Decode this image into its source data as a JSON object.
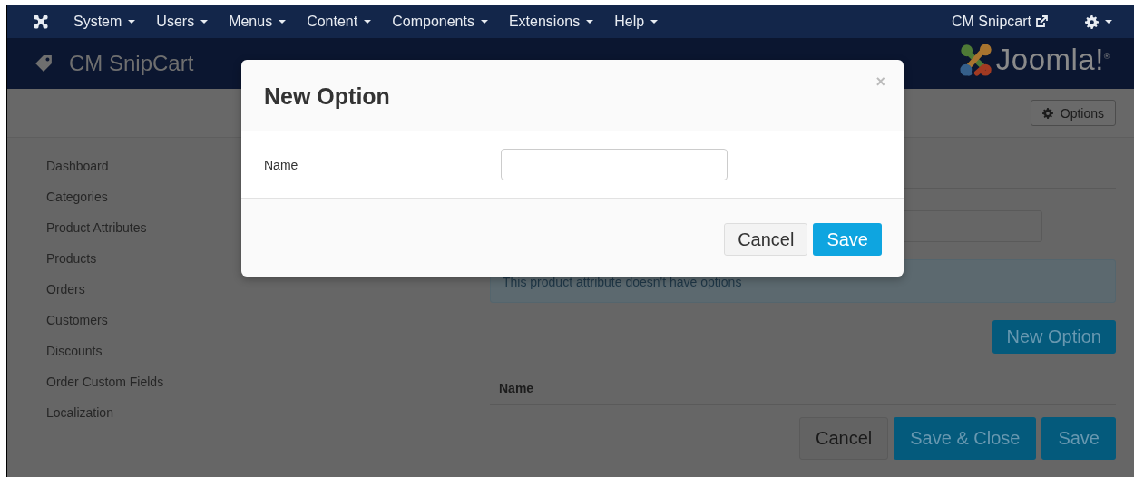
{
  "navbar": {
    "menus": [
      {
        "label": "System"
      },
      {
        "label": "Users"
      },
      {
        "label": "Menus"
      },
      {
        "label": "Content"
      },
      {
        "label": "Components"
      },
      {
        "label": "Extensions"
      },
      {
        "label": "Help"
      }
    ],
    "site_link": "CM Snipcart"
  },
  "header": {
    "title": "CM SnipCart",
    "brand": "Joomla!$^{®}$"
  },
  "toolbar": {
    "buttons": [
      {
        "label": "Options"
      }
    ]
  },
  "sidebar": {
    "items": [
      {
        "label": "Dashboard"
      },
      {
        "label": "Categories"
      },
      {
        "label": "Product Attributes"
      },
      {
        "label": "Products"
      },
      {
        "label": "Orders"
      },
      {
        "label": "Customers"
      },
      {
        "label": "Discounts"
      },
      {
        "label": "Order Custom Fields"
      },
      {
        "label": "Localization"
      }
    ]
  },
  "form": {
    "empty_message": "This product attribute doesn't have options",
    "new_option_button": "New Option",
    "table": {
      "columns": [
        "Name"
      ]
    }
  },
  "actions": [
    {
      "label": "Cancel",
      "kind": "default"
    },
    {
      "label": "Save & Close",
      "kind": "primary"
    },
    {
      "label": "Save",
      "kind": "primary"
    }
  ],
  "modal": {
    "title": "New Option",
    "close": "×",
    "fields": [
      {
        "label": "Name"
      }
    ],
    "buttons": [
      {
        "label": "Cancel",
        "kind": "default"
      },
      {
        "label": "Save",
        "kind": "primary"
      }
    ]
  }
}
